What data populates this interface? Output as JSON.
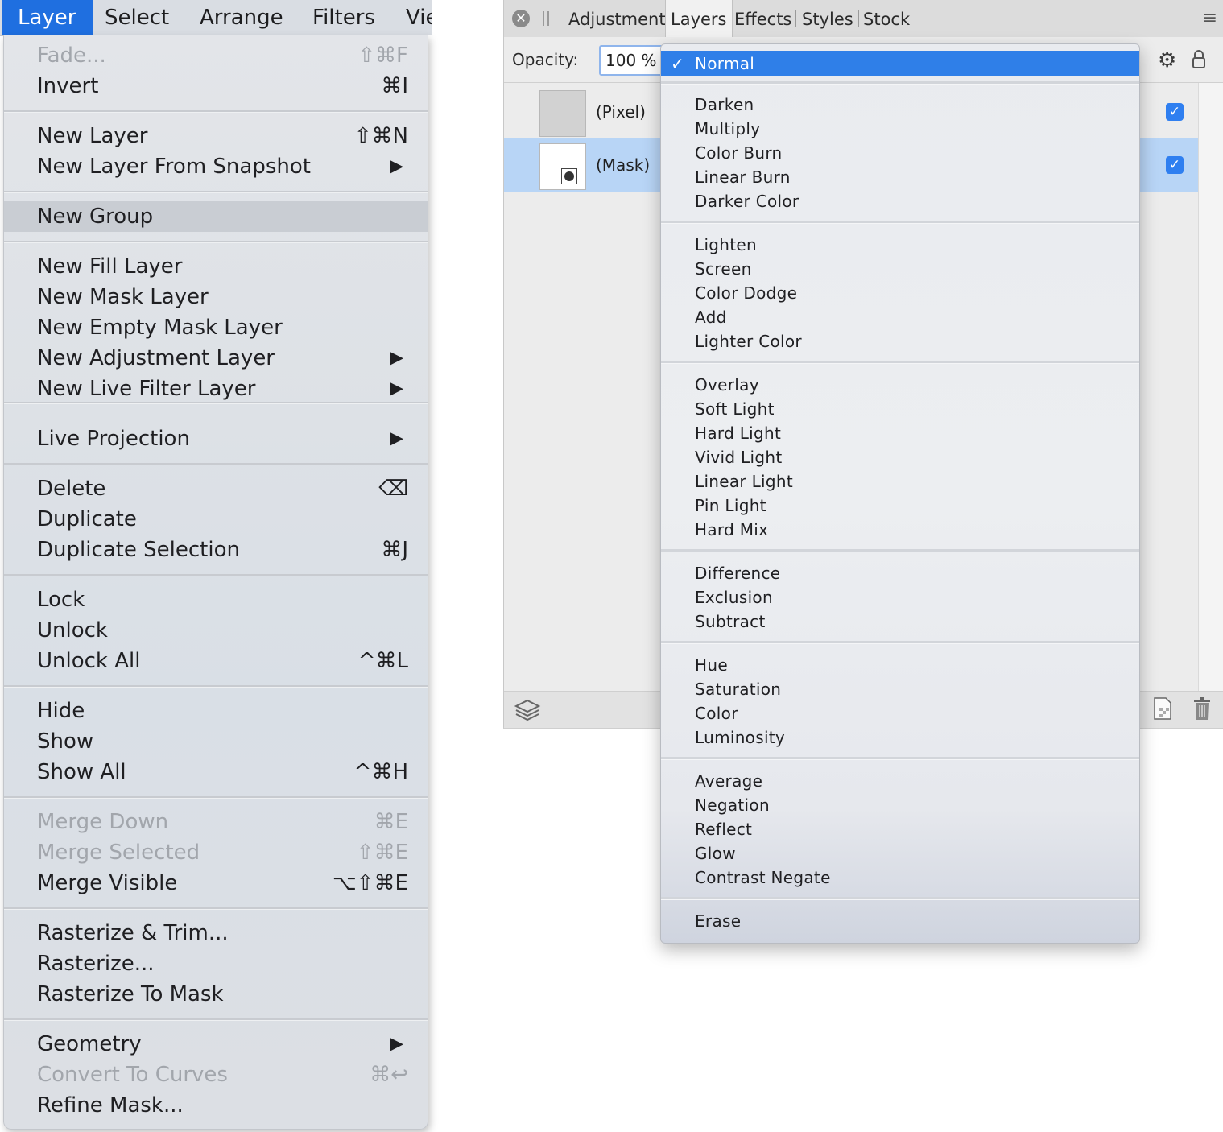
{
  "menubar": {
    "items": [
      "Layer",
      "Select",
      "Arrange",
      "Filters",
      "Vie"
    ],
    "active": "Layer"
  },
  "layer_menu": {
    "items": [
      {
        "label": "Fade...",
        "shortcut": "⇧⌘F",
        "disabled": true
      },
      {
        "label": "Invert",
        "shortcut": "⌘I"
      },
      {
        "label": "New Layer",
        "shortcut": "⇧⌘N"
      },
      {
        "label": "New Layer From Snapshot",
        "submenu": true
      },
      {
        "label": "New Group",
        "hover": true
      },
      {
        "label": "New Fill Layer"
      },
      {
        "label": "New Mask Layer"
      },
      {
        "label": "New Empty Mask Layer"
      },
      {
        "label": "New Adjustment Layer",
        "submenu": true
      },
      {
        "label": "New Live Filter Layer",
        "submenu": true
      },
      {
        "label": "Live Projection",
        "submenu": true
      },
      {
        "label": "Delete",
        "shortcut": "⌫"
      },
      {
        "label": "Duplicate"
      },
      {
        "label": "Duplicate Selection",
        "shortcut": "⌘J"
      },
      {
        "label": "Lock"
      },
      {
        "label": "Unlock"
      },
      {
        "label": "Unlock All",
        "shortcut": "^⌘L"
      },
      {
        "label": "Hide"
      },
      {
        "label": "Show"
      },
      {
        "label": "Show All",
        "shortcut": "^⌘H"
      },
      {
        "label": "Merge Down",
        "shortcut": "⌘E",
        "disabled": true
      },
      {
        "label": "Merge Selected",
        "shortcut": "⇧⌘E",
        "disabled": true
      },
      {
        "label": "Merge Visible",
        "shortcut": "⌥⇧⌘E"
      },
      {
        "label": "Rasterize & Trim..."
      },
      {
        "label": "Rasterize..."
      },
      {
        "label": "Rasterize To Mask"
      },
      {
        "label": "Geometry",
        "submenu": true
      },
      {
        "label": "Convert To Curves",
        "shortcut": "⌘↩",
        "disabled": true
      },
      {
        "label": "Refine Mask..."
      }
    ],
    "submenu_arrow": "▶"
  },
  "panel": {
    "tabs": [
      "Adjustment",
      "Layers",
      "Effects",
      "Styles",
      "Stock"
    ],
    "active_tab": "Layers",
    "close_icon": "close-icon",
    "menu_icon": "≡",
    "opacity_label": "Opacity:",
    "opacity_value": "100 %",
    "layers": [
      {
        "name": "(Pixel)",
        "visible": true,
        "selected": false
      },
      {
        "name": "(Mask)",
        "visible": true,
        "selected": true
      }
    ],
    "check_glyph": "✓"
  },
  "blend_modes": {
    "selected": "Normal",
    "check_glyph": "✓",
    "groups": [
      [
        "Normal"
      ],
      [
        "Darken",
        "Multiply",
        "Color Burn",
        "Linear Burn",
        "Darker Color"
      ],
      [
        "Lighten",
        "Screen",
        "Color Dodge",
        "Add",
        "Lighter Color"
      ],
      [
        "Overlay",
        "Soft Light",
        "Hard Light",
        "Vivid Light",
        "Linear Light",
        "Pin Light",
        "Hard Mix"
      ],
      [
        "Difference",
        "Exclusion",
        "Subtract"
      ],
      [
        "Hue",
        "Saturation",
        "Color",
        "Luminosity"
      ],
      [
        "Average",
        "Negation",
        "Reflect",
        "Glow",
        "Contrast Negate"
      ],
      [
        "Erase"
      ]
    ]
  },
  "colors": {
    "accent": "#1f6fe0",
    "selection": "#2f7fe8",
    "layer_selected": "#b8d5f6"
  }
}
